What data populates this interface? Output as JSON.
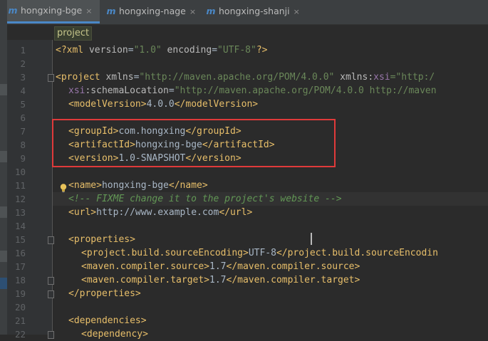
{
  "tabs": [
    {
      "label": "hongxing-bge",
      "icon": "maven-file-icon",
      "active": true
    },
    {
      "label": "hongxing-nage",
      "icon": "maven-file-icon",
      "active": false
    },
    {
      "label": "hongxing-shanji",
      "icon": "maven-file-icon",
      "active": false
    }
  ],
  "file_icon_glyph": "m",
  "close_glyph": "×",
  "breadcrumb": "project",
  "line_numbers": [
    "1",
    "2",
    "3",
    "4",
    "5",
    "6",
    "7",
    "8",
    "9",
    "10",
    "11",
    "12",
    "13",
    "14",
    "15",
    "16",
    "17",
    "18",
    "19",
    "20",
    "21",
    "22"
  ],
  "code": {
    "l1": {
      "a": "<?xml ",
      "b": "version",
      "c": "=",
      "d": "\"1.0\"",
      "e": " encoding",
      "f": "=",
      "g": "\"UTF-8\"",
      "h": "?>"
    },
    "l3": {
      "a": "<project ",
      "b": "xmlns",
      "c": "=",
      "d": "\"http://maven.apache.org/POM/4.0.0\"",
      "e": " xmlns:",
      "f": "xsi",
      "g": "=\"http:/"
    },
    "l4": {
      "a": "xsi",
      "b": ":schemaLocation",
      "c": "=",
      "d": "\"http://maven.apache.org/POM/4.0.0 http://maven"
    },
    "l5": {
      "a": "<modelVersion>",
      "b": "4.0.0",
      "c": "</modelVersion>"
    },
    "l7": {
      "a": "<groupId>",
      "b": "com.hongxing",
      "c": "</groupId>"
    },
    "l8": {
      "a": "<artifactId>",
      "b": "hongxing-bge",
      "c": "</artifactId>"
    },
    "l9": {
      "a": "<version>",
      "b": "1.0-SNAPSHOT",
      "c": "</version>"
    },
    "l11": {
      "a": "<name>",
      "b": "hongxing-bge",
      "c": "</name>"
    },
    "l12": {
      "a": "<!-- FIXME change it to the project's ",
      "b": "website -->"
    },
    "l13": {
      "a": "<url>",
      "b": "http://www.example.com",
      "c": "</url>"
    },
    "l15": {
      "a": "<properties>"
    },
    "l16": {
      "a": "<project.build.sourceEncoding>",
      "b": "UTF-8",
      "c": "</project.build.sourceEncodin"
    },
    "l17": {
      "a": "<maven.compiler.source>",
      "b": "1.7",
      "c": "</maven.compiler.source>"
    },
    "l18": {
      "a": "<maven.compiler.target>",
      "b": "1.7",
      "c": "</maven.compiler.target>"
    },
    "l19": {
      "a": "</properties>"
    },
    "l21": {
      "a": "<dependencies>"
    },
    "l22": {
      "a": "<dependency>"
    }
  },
  "colors": {
    "editor_bg": "#2b2b2b",
    "gutter_bg": "#313335",
    "tag": "#e8bf6a",
    "attribute_value": "#6a8759",
    "comment": "#629755",
    "namespace": "#9876aa",
    "highlight_box": "#e03a3a",
    "active_tab_underline": "#4a88c7"
  }
}
